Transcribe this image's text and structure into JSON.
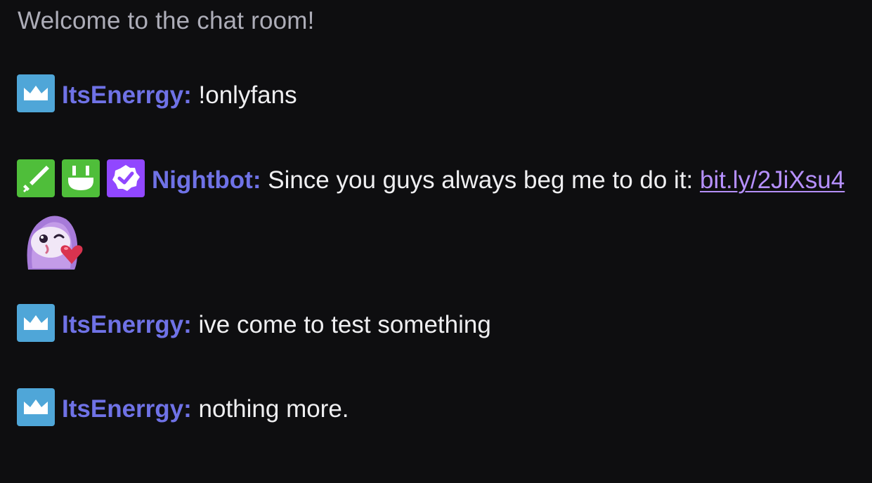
{
  "chat": {
    "welcome": "Welcome to the chat room!",
    "messages": [
      {
        "user": "ItsEnerrgy:",
        "text": "!onlyfans",
        "badges": [
          "crown-icon"
        ]
      },
      {
        "user": "Nightbot:",
        "text": "Since you guys always beg me to do it:",
        "link": "bit.ly/2JiXsu4",
        "emote": "heart-kiss-emote",
        "badges": [
          "sword-icon",
          "smile-icon",
          "verified-icon"
        ]
      },
      {
        "user": "ItsEnerrgy:",
        "text": "ive come to test something",
        "badges": [
          "crown-icon"
        ]
      },
      {
        "user": "ItsEnerrgy:",
        "text": "nothing more.",
        "badges": [
          "crown-icon"
        ]
      }
    ]
  },
  "colors": {
    "background": "#0e0e10",
    "username": "#6f72e6",
    "link": "#b690ff",
    "crown_badge": "#4fa6d8",
    "green_badge": "#4fbe3a",
    "verified_badge": "#9147ff"
  }
}
